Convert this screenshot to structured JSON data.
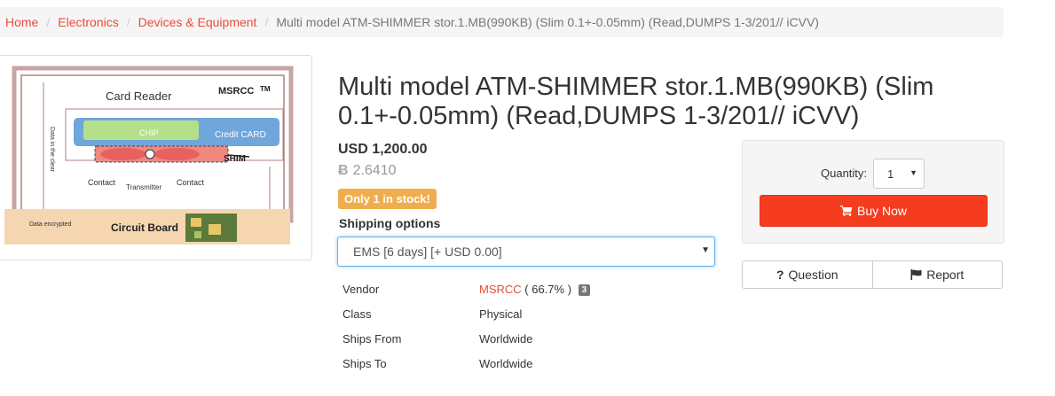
{
  "breadcrumb": {
    "items": [
      "Home",
      "Electronics",
      "Devices & Equipment"
    ],
    "current": "Multi model ATM-SHIMMER stor.1.MB(990KB) (Slim 0.1+-0.05mm) (Read,DUMPS 1-3/201// iCVV)"
  },
  "product": {
    "title": "Multi model ATM-SHIMMER stor.1.MB(990KB) (Slim 0.1+-0.05mm) (Read,DUMPS 1-3/201// iCVV)",
    "price_usd": "USD 1,200.00",
    "price_btc": "2.6410",
    "btc_symbol": "Ƀ",
    "stock_badge": "Only 1 in stock!"
  },
  "image": {
    "card_reader": "Card Reader",
    "brand": "MSRCC",
    "tm": "TM",
    "credit_card": "Credit CARD",
    "chip": "CHIP",
    "shim": "SHIM",
    "contact_left": "Contact",
    "transmitter": "Transmitter",
    "contact_right": "Contact",
    "data_clear": "Data in the clear",
    "data_encrypted": "Data encrypted",
    "circuit_board": "Circuit Board"
  },
  "shipping": {
    "label": "Shipping options",
    "selected": "EMS [6 days] [+ USD 0.00]"
  },
  "details": {
    "vendor_label": "Vendor",
    "vendor_name": "MSRCC",
    "vendor_rating": "( 66.7% )",
    "vendor_level": "3",
    "class_label": "Class",
    "class_value": "Physical",
    "ships_from_label": "Ships From",
    "ships_from_value": "Worldwide",
    "ships_to_label": "Ships To",
    "ships_to_value": "Worldwide"
  },
  "buy": {
    "quantity_label": "Quantity:",
    "quantity_value": "1",
    "buy_label": "Buy Now"
  },
  "actions": {
    "question_label": "Question",
    "report_label": "Report"
  },
  "colors": {
    "accent": "#e74c3c",
    "buy_button": "#f53c1f",
    "stock_badge": "#f0ad4e",
    "focus_border": "#66afe9"
  },
  "icons": {
    "cart": "cart-icon",
    "question": "question-icon",
    "flag": "flag-icon",
    "caret": "caret-down-icon"
  }
}
